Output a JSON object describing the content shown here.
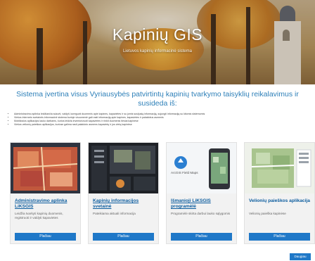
{
  "hero": {
    "title": "Kapinių GIS",
    "subtitle": "Lietuvos kapinių informacinė sistema"
  },
  "intro": {
    "heading": "Sistema įvertina visus Vyriausybės patvirtintų kapinių tvarkymo taisyklių reikalavimus ir susideda iš:",
    "bullets": [
      "Administravimo aplinka leidžiančia sukurti, valdyti, koreguoti duomenis apie kapines, kapavietes ir su jomis susijusią informaciją, sujungti informaciją su kitomis sistemomis",
      "Viešos interneto svetainės informacinė sistema kurioje visuomenė gali rasti informaciją apie kapines, kapavietes ir palaidotus asmenis",
      "Mobiliosios aplikacijos lauko darbams, kurios leidžia inventorizuoti kapavietes ir rinkti duomenis tiesiai kapinėse",
      "Viešos velionių paieškos aplikacijos, kuriose galima rasti palaidoto asmens kapavietę ir jos vietą kapinėse"
    ]
  },
  "cards": [
    {
      "title": "Administravimo aplinka LiKSGIS",
      "description": "Leidžia tvarkyti kapinių duomenis, registruoti ir valdyti kapavietes",
      "button": "Plačiau",
      "thumb_icon": "cemetery-map-thumbnail"
    },
    {
      "title": "Kapinių informacijos svetainė",
      "description": "Pateikiama aktuali informacija",
      "button": "Plačiau",
      "thumb_icon": "dashboard-thumbnail"
    },
    {
      "title": "Išmanioji LiKSGIS programėlė",
      "description": "Programėlė skirta darbui lauko sąlygomis",
      "button": "Plačiau",
      "thumb_icon": "field-maps-thumbnail",
      "thumb_label": "ArcGIS Field Maps"
    },
    {
      "title": "Velionių paieškos aplikacija",
      "description": "Velionių paieška kapinėse",
      "button": "Plačiau",
      "thumb_icon": "search-map-thumbnail"
    }
  ],
  "more_button": "Daugiau",
  "colors": {
    "accent": "#1f78c8",
    "heading": "#2c7fb8",
    "card_bg": "#f2f2f2"
  }
}
